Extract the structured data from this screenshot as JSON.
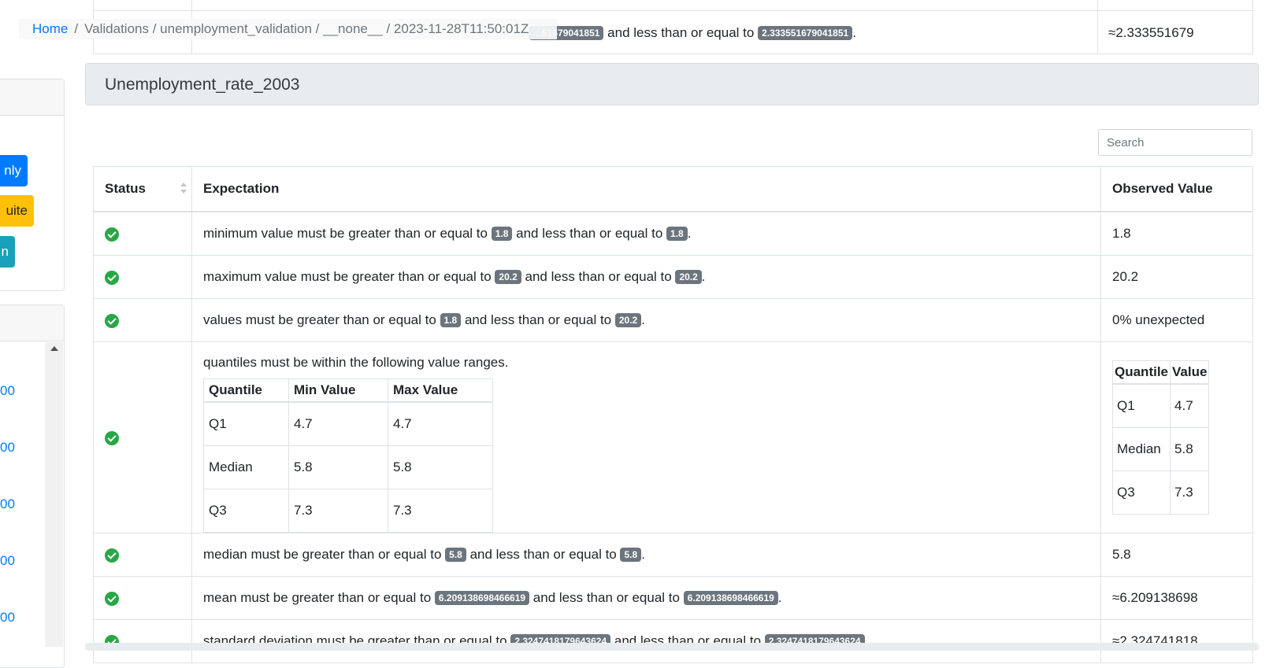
{
  "breadcrumb": {
    "home": "Home",
    "path": "Validations / unemployment_validation / __none__ / 2023-11-28T11:50:01Z"
  },
  "top_row": {
    "text_a": "and less than or equal to",
    "badge_a": "…51679041851",
    "badge_b": "2.333551679041851",
    "observed": "≈2.333551679"
  },
  "sidebar": {
    "buttons": [
      {
        "label": "nly",
        "color": "#007bff"
      },
      {
        "label": "uite",
        "color": "#ffc107"
      },
      {
        "label": "n",
        "color": "#17a2b8"
      }
    ],
    "links": [
      "00",
      "00",
      "00",
      "00",
      "00"
    ]
  },
  "section": {
    "title": "Unemployment_rate_2003"
  },
  "search": {
    "placeholder": "Search"
  },
  "table": {
    "headers": {
      "status": "Status",
      "expectation": "Expectation",
      "observed": "Observed Value"
    },
    "rows": [
      {
        "pre": "minimum value must be greater than or equal to",
        "v1": "1.8",
        "mid": "and less than or equal to",
        "v2": "1.8",
        "observed": "1.8"
      },
      {
        "pre": "maximum value must be greater than or equal to",
        "v1": "20.2",
        "mid": "and less than or equal to",
        "v2": "20.2",
        "observed": "20.2"
      },
      {
        "pre": "values must be greater than or equal to",
        "v1": "1.8",
        "mid": "and less than or equal to",
        "v2": "20.2",
        "observed": "0% unexpected"
      },
      {
        "pre": "median must be greater than or equal to",
        "v1": "5.8",
        "mid": "and less than or equal to",
        "v2": "5.8",
        "observed": "5.8"
      },
      {
        "pre": "mean must be greater than or equal to",
        "v1": "6.209138698466619",
        "mid": "and less than or equal to",
        "v2": "6.209138698466619",
        "observed": "≈6.209138698"
      },
      {
        "pre": "standard deviation must be greater than or equal to",
        "v1": "2.3247418179643624",
        "mid": "and less than or equal to",
        "v2": "2.3247418179643624",
        "observed": "≈2.324741818"
      }
    ],
    "quantile_row": {
      "text": "quantiles must be within the following value ranges.",
      "headers": [
        "Quantile",
        "Min Value",
        "Max Value"
      ],
      "rows": [
        [
          "Q1",
          "4.7",
          "4.7"
        ],
        [
          "Median",
          "5.8",
          "5.8"
        ],
        [
          "Q3",
          "7.3",
          "7.3"
        ]
      ],
      "observed_headers": [
        "Quantile",
        "Value"
      ],
      "observed_rows": [
        [
          "Q1",
          "4.7"
        ],
        [
          "Median",
          "5.8"
        ],
        [
          "Q3",
          "7.3"
        ]
      ]
    },
    "period": "."
  },
  "colors": {
    "success": "#28a745",
    "badge": "#6c757d",
    "link": "#007bff"
  }
}
